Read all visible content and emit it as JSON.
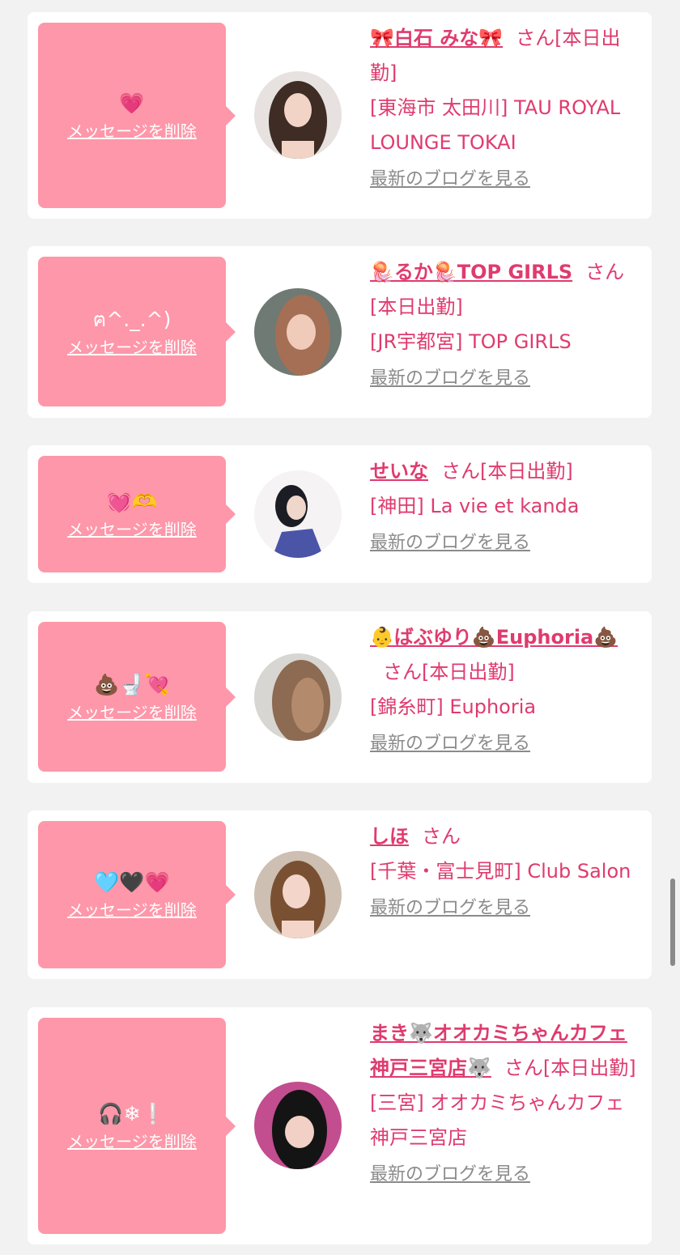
{
  "delete_label": "メッセージを削除",
  "blog_label": "最新のブログを見る",
  "cards": [
    {
      "message": "💗",
      "name": "🎀白石 みな🎀",
      "san": "さん[本日出勤]",
      "shop": "[東海市 太田川] TAU ROYAL LOUNGE TOKAI",
      "avatar_colors": [
        "#e7e2df",
        "#3e2c25",
        "#f2d4c6"
      ]
    },
    {
      "message": "ฅ^._.^)",
      "name": "🪼るか🪼TOP GIRLS",
      "san": "さん[本日出勤]",
      "shop": "[JR宇都宮] TOP GIRLS",
      "avatar_colors": [
        "#6e7a73",
        "#a46f55",
        "#f0cbb9"
      ]
    },
    {
      "message": "💓🫶",
      "name": "せいな",
      "san": "さん[本日出勤]",
      "shop": "[神田] La vie et kanda",
      "avatar_colors": [
        "#f5f3f4",
        "#1c1c24",
        "#4a55a8"
      ]
    },
    {
      "message": "💩🚽💘",
      "name": "👶ばぶゆり💩Euphoria💩",
      "san": "さん[本日出勤]",
      "shop": "[錦糸町] Euphoria",
      "avatar_colors": [
        "#d8d6d2",
        "#8d6a52",
        "#b38a6c"
      ]
    },
    {
      "message": "🩵🖤💗",
      "name": "しほ",
      "san": "さん",
      "shop": "[千葉・富士見町] Club Salon",
      "avatar_colors": [
        "#cdbfb1",
        "#7a5033",
        "#f3d6c9"
      ]
    },
    {
      "message": "🎧❄❕",
      "name": "まき🐺オオカミちゃんカフェ神戸三宮店🐺",
      "san": "さん[本日出勤]",
      "shop": "[三宮] オオカミちゃんカフェ神戸三宮店",
      "avatar_colors": [
        "#c24d8f",
        "#141414",
        "#f2d0c6"
      ]
    }
  ]
}
